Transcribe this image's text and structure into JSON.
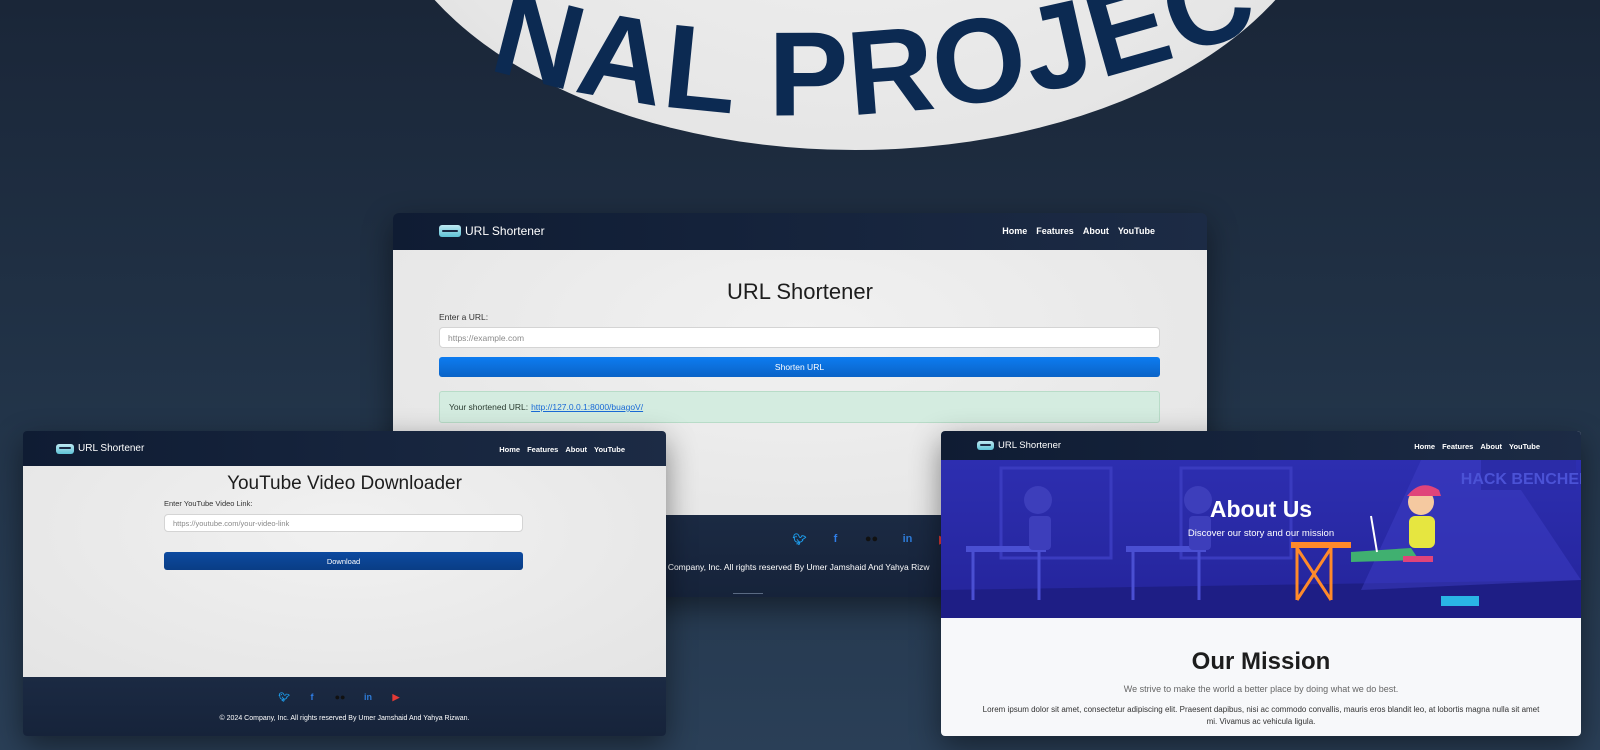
{
  "banner": {
    "title": "FINAL PROJECT"
  },
  "brand": {
    "name": "URL Shortener"
  },
  "nav": {
    "links": [
      "Home",
      "Features",
      "About",
      "YouTube"
    ]
  },
  "shortener_page": {
    "heading": "URL Shortener",
    "input_label": "Enter a URL:",
    "input_placeholder": "https://example.com",
    "button_label": "Shorten URL",
    "result_prefix": "Your shortened URL:",
    "result_link": "http://127.0.0.1:8000/buagoV/"
  },
  "youtube_page": {
    "heading": "YouTube Video Downloader",
    "input_label": "Enter YouTube Video Link:",
    "input_placeholder": "https://youtube.com/your-video-link",
    "button_label": "Download"
  },
  "about_page": {
    "hero_title": "About Us",
    "hero_subtitle": "Discover our story and our mission",
    "hero_poster_text": "HACK BENCHERS",
    "mission_title": "Our Mission",
    "mission_subtitle": "We strive to make the world a better place by doing what we do best.",
    "mission_body": "Lorem ipsum dolor sit amet, consectetur adipiscing elit. Praesent dapibus, nisi ac commodo convallis, mauris eros blandit leo, at lobortis magna nulla sit amet mi. Vivamus ac vehicula ligula."
  },
  "footer": {
    "socials": [
      "twitter-icon",
      "facebook-icon",
      "flickr-icon",
      "linkedin-icon",
      "youtube-icon"
    ],
    "copyright": "© 2024 Company, Inc. All rights reserved By Umer Jamshaid And Yahya Rizwan.",
    "copyright_main_visible": "24 Company, Inc. All rights reserved By Umer Jamshaid And Yahya Rizw"
  },
  "colors": {
    "background": "#1f2d40",
    "nav": "#162238",
    "primary_button": "#0a6fe0",
    "download_button": "#0b4595",
    "result_box": "#d4ece0",
    "hero": "#2a2bab",
    "banner_text": "#0c2a52"
  }
}
